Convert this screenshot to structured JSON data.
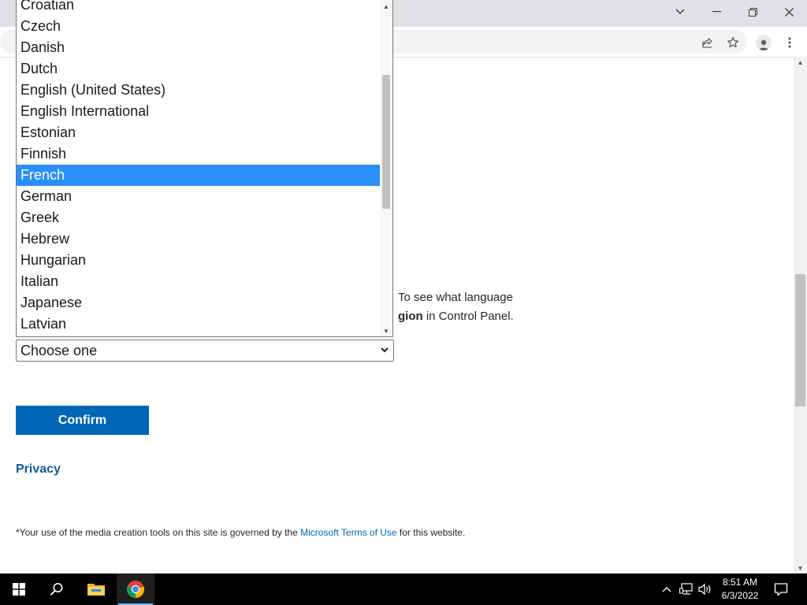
{
  "window": {
    "controls": [
      "chevron-down",
      "minimize",
      "restore",
      "close"
    ]
  },
  "dropdown": {
    "options": [
      {
        "label": "Croatian",
        "selected": false
      },
      {
        "label": "Czech",
        "selected": false
      },
      {
        "label": "Danish",
        "selected": false
      },
      {
        "label": "Dutch",
        "selected": false
      },
      {
        "label": "English (United States)",
        "selected": false
      },
      {
        "label": "English International",
        "selected": false
      },
      {
        "label": "Estonian",
        "selected": false
      },
      {
        "label": "Finnish",
        "selected": false
      },
      {
        "label": "French",
        "selected": true
      },
      {
        "label": "German",
        "selected": false
      },
      {
        "label": "Greek",
        "selected": false
      },
      {
        "label": "Hebrew",
        "selected": false
      },
      {
        "label": "Hungarian",
        "selected": false
      },
      {
        "label": "Italian",
        "selected": false
      },
      {
        "label": "Japanese",
        "selected": false
      },
      {
        "label": "Latvian",
        "selected": false
      }
    ],
    "selected_color": "#2b8ff8"
  },
  "page": {
    "para_line1": "To see what language",
    "para_line2_bold": "gion",
    "para_line2_rest": " in Control Panel.",
    "select_value": "Choose one",
    "confirm_label": "Confirm",
    "privacy_label": "Privacy",
    "legal_prefix": "*Your use of the media creation tools on this site is governed by the ",
    "legal_link": "Microsoft Terms of Use",
    "legal_suffix": " for this website.",
    "accent_color": "#0067b8"
  },
  "taskbar": {
    "time": "8:51 AM",
    "date": "6/3/2022",
    "items": [
      "windows-start",
      "search",
      "file-explorer",
      "chrome"
    ]
  }
}
